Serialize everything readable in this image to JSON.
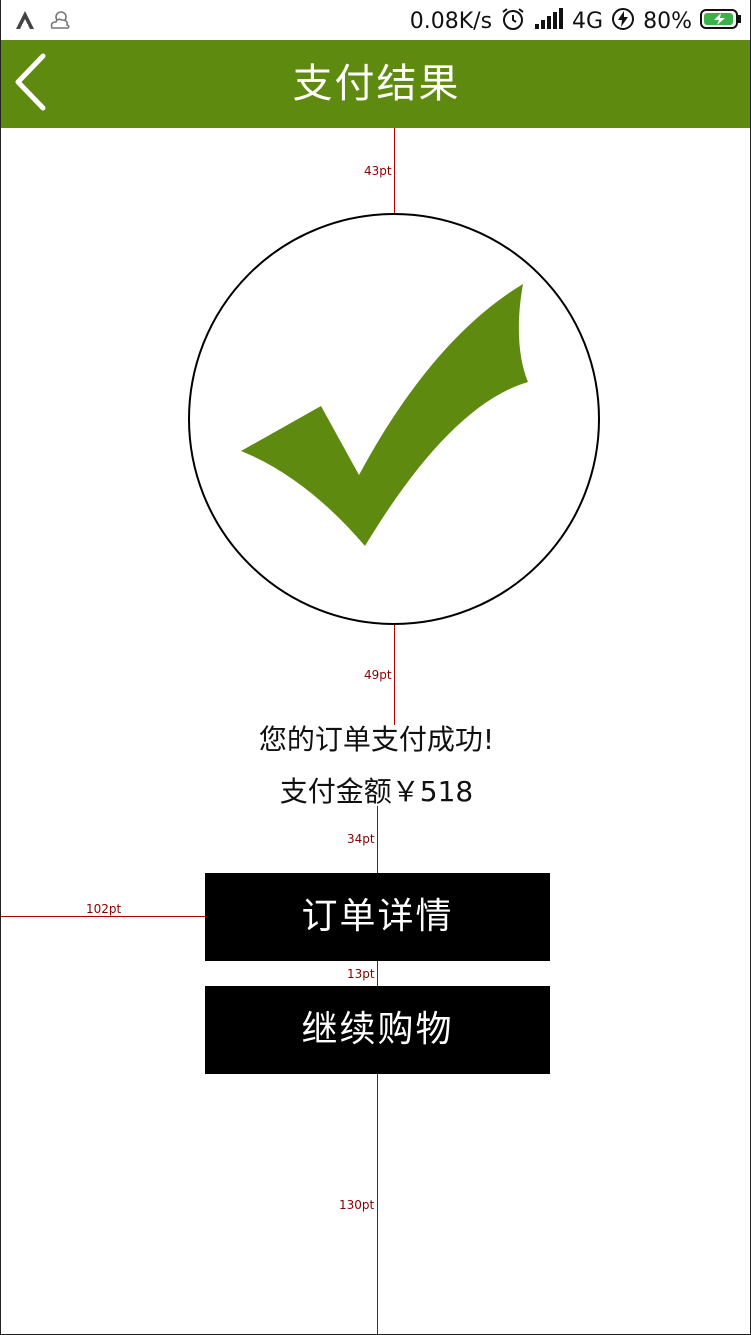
{
  "status_bar": {
    "network_speed": "0.08K/s",
    "network_type": "4G",
    "battery_percent": "80%",
    "icons": [
      "app-icon",
      "weather-icon",
      "alarm-icon",
      "signal-icon",
      "charging-icon",
      "battery-icon"
    ]
  },
  "header": {
    "title": "支付结果",
    "back_icon": "chevron-left-icon",
    "background": "#5e8a0f"
  },
  "result": {
    "icon": "check-icon",
    "accent_color": "#5e8a0f",
    "message": "您的订单支付成功!",
    "amount_text": "支付金额￥518"
  },
  "buttons": {
    "order_detail": "订单详情",
    "continue_shopping": "继续购物"
  },
  "annotations": {
    "top_gap": "43pt",
    "circle_gap": "49pt",
    "amount_gap": "34pt",
    "left_margin": "102pt",
    "button_gap": "13pt",
    "bottom_gap": "130pt"
  }
}
